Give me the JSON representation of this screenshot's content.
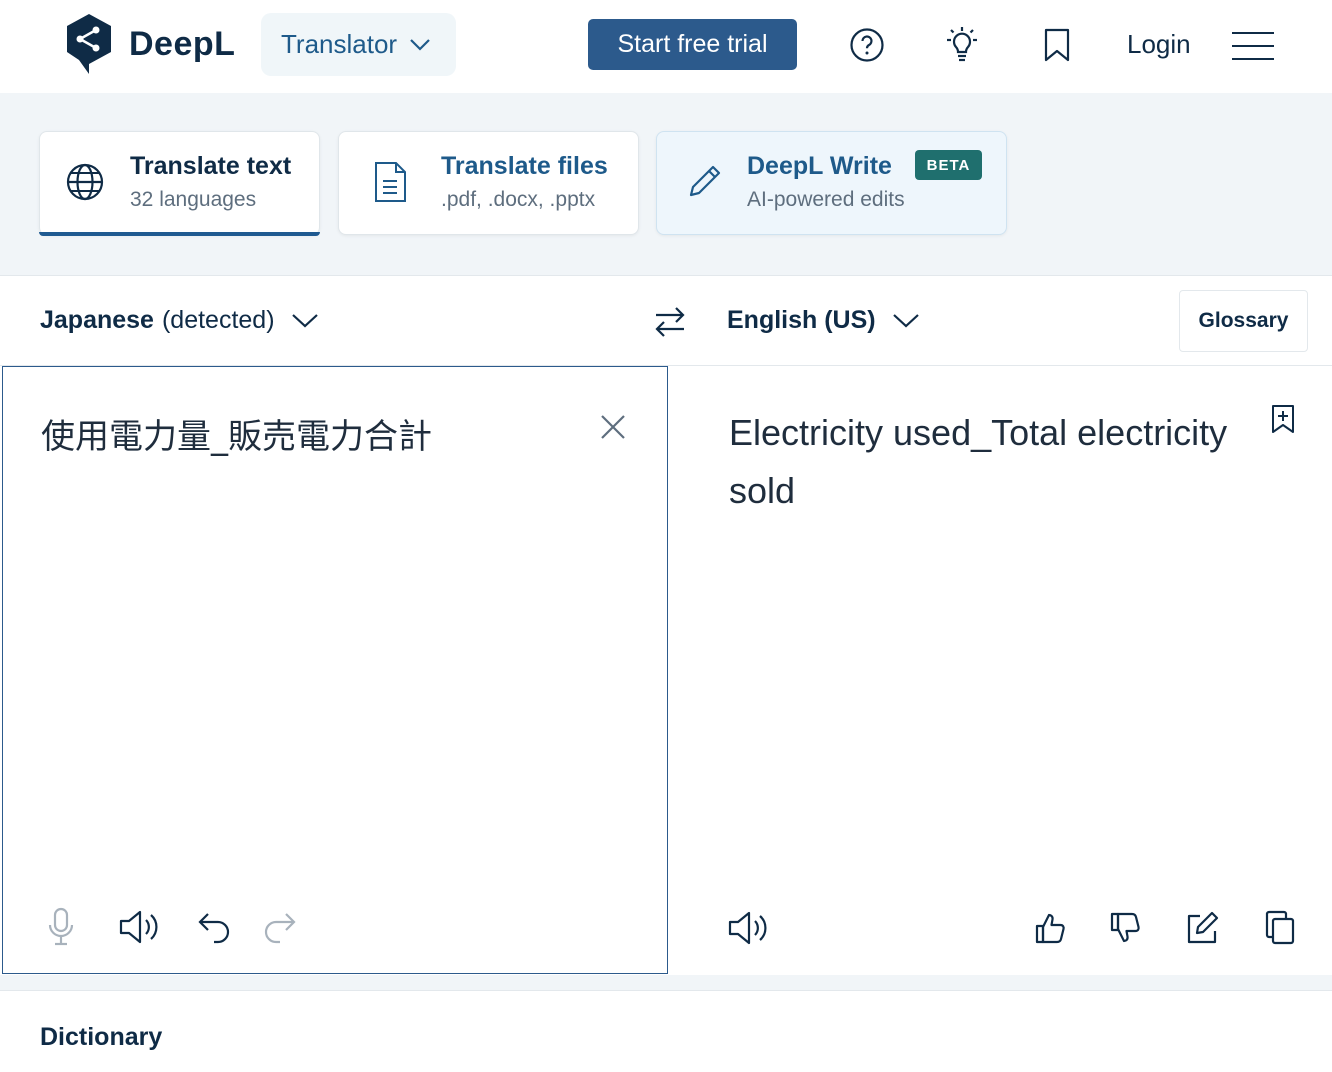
{
  "header": {
    "brand": "DeepL",
    "product_switch": "Translator",
    "trial_button": "Start free trial",
    "login": "Login",
    "icons": [
      "help-circle-icon",
      "lightbulb-icon",
      "bookmark-icon",
      "hamburger-menu-icon"
    ]
  },
  "modes": [
    {
      "title": "Translate text",
      "subtitle": "32 languages",
      "icon": "globe-icon",
      "active": true
    },
    {
      "title": "Translate files",
      "subtitle": ".pdf, .docx, .pptx",
      "icon": "document-icon"
    },
    {
      "title": "DeepL Write",
      "subtitle": "AI-powered edits",
      "icon": "pencil-icon",
      "badge": "BETA"
    }
  ],
  "translator": {
    "source_lang": "Japanese",
    "source_detected": "(detected)",
    "target_lang": "English (US)",
    "glossary": "Glossary",
    "source_text": "使用電力量_販売電力合計",
    "target_text": "Electricity used_Total electricity sold"
  },
  "dictionary": {
    "title": "Dictionary"
  },
  "colors": {
    "primary": "#2c5a8c",
    "navy_text": "#0f2b46",
    "beta_badge": "#1f6f6e",
    "panel_bg": "#f1f5f8"
  }
}
